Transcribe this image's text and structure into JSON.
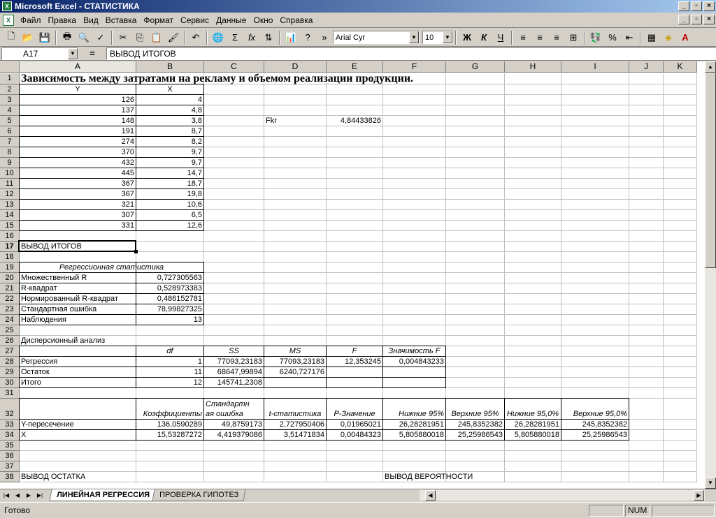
{
  "window": {
    "title": "Microsoft Excel - СТАТИСТИКА"
  },
  "menu": [
    "Файл",
    "Правка",
    "Вид",
    "Вставка",
    "Формат",
    "Сервис",
    "Данные",
    "Окно",
    "Справка"
  ],
  "toolbar": {
    "font_name": "Arial Cyr",
    "font_size": "10",
    "bold": "Ж",
    "italic": "К",
    "underline": "Ч",
    "percent": "%",
    "sigma": "Σ",
    "fx": "fx"
  },
  "formula": {
    "cell_ref": "A17",
    "eq": "=",
    "content": "ВЫВОД ИТОГОВ"
  },
  "columns": [
    "A",
    "B",
    "C",
    "D",
    "E",
    "F",
    "G",
    "H",
    "I",
    "J",
    "K"
  ],
  "rows": [
    "1",
    "2",
    "3",
    "4",
    "5",
    "6",
    "7",
    "8",
    "9",
    "10",
    "11",
    "12",
    "13",
    "14",
    "15",
    "16",
    "17",
    "18",
    "19",
    "20",
    "21",
    "22",
    "23",
    "24",
    "25",
    "26",
    "27",
    "28",
    "29",
    "30",
    "31",
    "32",
    "33",
    "34",
    "35",
    "36",
    "37",
    "38"
  ],
  "cells": {
    "title": "Зависимость между затратами на рекламу и объемом реализации продукции.",
    "hdr_y": "Y",
    "hdr_x": "X",
    "y": [
      "126",
      "137",
      "148",
      "191",
      "274",
      "370",
      "432",
      "445",
      "367",
      "367",
      "321",
      "307",
      "331"
    ],
    "x": [
      "4",
      "4,8",
      "3,8",
      "8,7",
      "8,2",
      "9,7",
      "9,7",
      "14,7",
      "18,7",
      "19,8",
      "10,6",
      "6,5",
      "12,6"
    ],
    "fkr_label": "Fkr",
    "fkr_value": "4,84433826",
    "summary": "ВЫВОД ИТОГОВ",
    "reg_stat": "Регрессионная статистика",
    "stats": [
      {
        "label": "Множественный R",
        "value": "0,727305563"
      },
      {
        "label": "R-квадрат",
        "value": "0,528973383"
      },
      {
        "label": "Нормированный R-квадрат",
        "value": "0,486152781"
      },
      {
        "label": "Стандартная ошибка",
        "value": "78,99827325"
      },
      {
        "label": "Наблюдения",
        "value": "13"
      }
    ],
    "anova": "Дисперсионный анализ",
    "anova_hdr": [
      "df",
      "SS",
      "MS",
      "F",
      "Значимость F"
    ],
    "anova_rows": [
      {
        "label": "Регрессия",
        "df": "1",
        "ss": "77093,23183",
        "ms": "77093,23183",
        "f": "12,353245",
        "sig": "0,004843233"
      },
      {
        "label": "Остаток",
        "df": "11",
        "ss": "68647,99894",
        "ms": "6240,727176",
        "f": "",
        "sig": ""
      },
      {
        "label": "Итого",
        "df": "12",
        "ss": "145741,2308",
        "ms": "",
        "f": "",
        "sig": ""
      }
    ],
    "coef_hdr": [
      "Коэффициенты",
      "Стандартн",
      "ая ошибка",
      "t-статистика",
      "P-Значение",
      "Нижние 95%",
      "Верхние 95%",
      "Нижние 95,0%",
      "Верхние 95,0%"
    ],
    "coef_rows": [
      {
        "label": "Y-пересечение",
        "v": [
          "136,0590289",
          "49,8759173",
          "2,727950406",
          "0,01965021",
          "26,28281951",
          "245,8352382",
          "26,28281951",
          "245,8352382"
        ]
      },
      {
        "label": "X",
        "v": [
          "15,53287272",
          "4,419379086",
          "3,51471834",
          "0,00484323",
          "5,805880018",
          "25,25986543",
          "5,805880018",
          "25,25986543"
        ]
      }
    ],
    "residual": "ВЫВОД ОСТАТКА",
    "probability": "ВЫВОД ВЕРОЯТНОСТИ"
  },
  "tabs": [
    "ЛИНЕЙНАЯ РЕГРЕССИЯ",
    "ПРОВЕРКА ГИПОТЕЗ"
  ],
  "status": {
    "text": "Готово",
    "num": "NUM"
  }
}
